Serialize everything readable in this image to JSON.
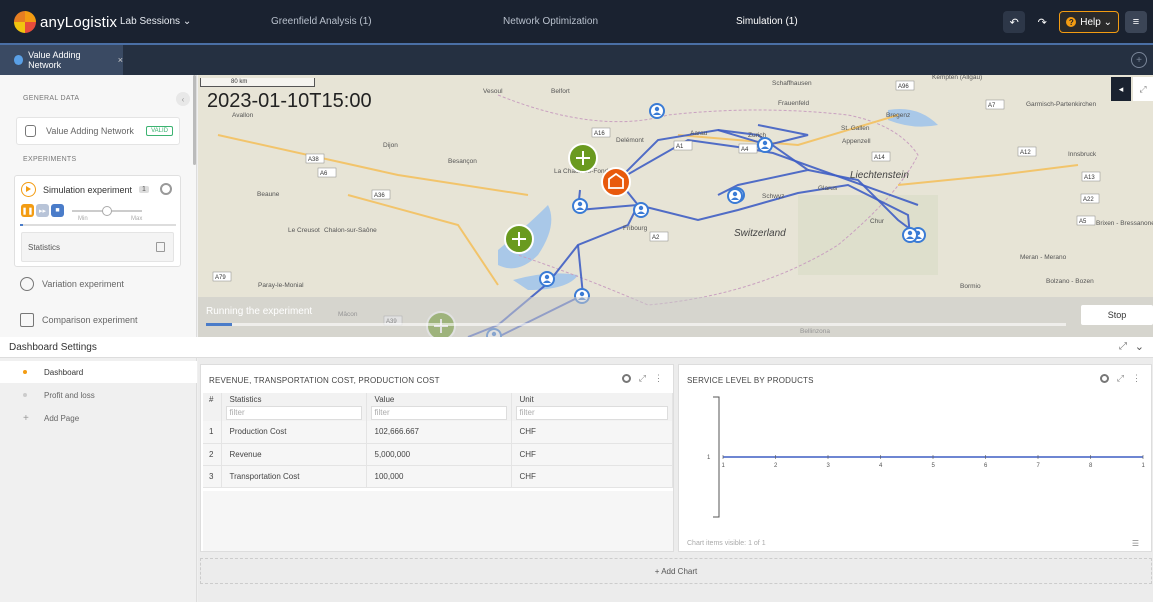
{
  "app": {
    "logo_text": "anyLogistix",
    "nav": [
      "Lab Sessions ⌄",
      "Greenfield Analysis (1)",
      "Network Optimization",
      "Simulation (1)"
    ],
    "help_label": "Help ⌄"
  },
  "tabs": {
    "active_label": "Value Adding Network",
    "close": "×",
    "add": "+"
  },
  "left_panel": {
    "general_label": "GENERAL DATA",
    "collapse_glyph": "‹",
    "network_label": "Value Adding Network",
    "valid_badge": "VALID",
    "experiments_label": "EXPERIMENTS",
    "simulation": {
      "label": "Simulation experiment",
      "count": "1",
      "speed_min": "Min",
      "speed_max": "Max",
      "speed_level": 0.5,
      "progress": 0.02,
      "statistics_label": "Statistics"
    },
    "variation_label": "Variation experiment",
    "comparison_label": "Comparison experiment"
  },
  "map": {
    "scale_label": "80 km",
    "sim_time": "2023-01-10T15:00",
    "running_label": "Running the experiment",
    "run_progress": 0.03,
    "stop_label": "Stop",
    "collapse_glyph": "◂",
    "expand_glyph": "⤢",
    "place_labels": [
      "Vesoul",
      "Belfort",
      "Schaffhausen",
      "Kempten (Allgäu)",
      "Avallon",
      "Dijon",
      "Besançon",
      "Delémont",
      "Aarau",
      "Zurich",
      "Frauenfeld",
      "St. Gallen",
      "Bregenz",
      "Appenzell",
      "Garmisch-Partenkirchen",
      "Innsbruck",
      "Liechtenstein",
      "Beaune",
      "La Chaux-de-Fonds",
      "Schwyz",
      "Glarus",
      "Le Creusot",
      "Chalon-sur-Saône",
      "Fribourg",
      "Switzerland",
      "Chur",
      "Meran - Merano",
      "Brixen - Bressanone",
      "Paray-le-Monial",
      "Bormio",
      "Bolzano - Bozen",
      "Mâcon",
      "Bellinzona"
    ],
    "road_labels": [
      "A36",
      "A16",
      "A38",
      "A6",
      "A1",
      "A4",
      "A14",
      "A96",
      "A7",
      "A12",
      "A13",
      "A22",
      "A5",
      "A2",
      "A79",
      "A39"
    ],
    "colors": {
      "route": "#3f5ec4",
      "customer": "#3a7bd5",
      "warehouse": "#e8590c",
      "supplier": "#6a9a1f"
    }
  },
  "dashboard": {
    "title": "Dashboard Settings",
    "expand_glyph": "⤢",
    "chevron_glyph": "⌄",
    "nav": {
      "dashboard": "Dashboard",
      "profit_loss": "Profit and loss",
      "add_page": "Add Page",
      "add_glyph": "+"
    },
    "table_widget": {
      "title": "REVENUE, TRANSPORTATION COST, PRODUCTION COST",
      "columns": [
        "#",
        "Statistics",
        "Value",
        "Unit"
      ],
      "filter_placeholder": "filter",
      "rows": [
        {
          "n": "1",
          "stat": "Production Cost",
          "value": "102,666.667",
          "unit": "CHF"
        },
        {
          "n": "2",
          "stat": "Revenue",
          "value": "5,000,000",
          "unit": "CHF"
        },
        {
          "n": "3",
          "stat": "Transportation Cost",
          "value": "100,000",
          "unit": "CHF"
        }
      ]
    },
    "chart_widget": {
      "title": "SERVICE LEVEL BY PRODUCTS",
      "footer": "Chart items visible: 1 of 1",
      "legend_glyph": "☰"
    },
    "add_chart": "+ Add Chart",
    "widget_glyphs": {
      "expand": "⤢",
      "more": "⋮"
    }
  },
  "chart_data": {
    "type": "line",
    "x": [
      1,
      2,
      3,
      4,
      5,
      6,
      7,
      8,
      1
    ],
    "x_tick_labels": [
      "1",
      "2",
      "3",
      "4",
      "5",
      "6",
      "7",
      "8",
      "1"
    ],
    "y_tick_labels": [
      "1"
    ],
    "series": [
      {
        "values": [
          1,
          1,
          1,
          1,
          1,
          1,
          1,
          1,
          1
        ]
      }
    ],
    "title": "SERVICE LEVEL BY PRODUCTS",
    "ylim": [
      0,
      2
    ],
    "grid": false,
    "color": "#3f5ec4"
  }
}
